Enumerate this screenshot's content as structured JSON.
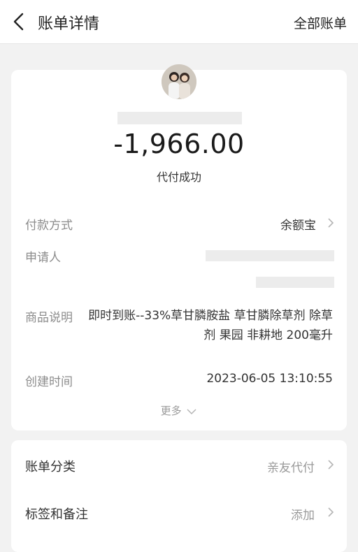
{
  "header": {
    "title": "账单详情",
    "right_link": "全部账单"
  },
  "summary": {
    "amount": "-1,966.00",
    "status": "代付成功"
  },
  "details": {
    "payment_method_label": "付款方式",
    "payment_method_value": "余额宝",
    "applicant_label": "申请人",
    "product_label": "商品说明",
    "product_value": "即时到账--33%草甘膦胺盐 草甘膦除草剂 除草剂 果园 非耕地 200毫升",
    "created_label": "创建时间",
    "created_value": "2023-06-05 13:10:55",
    "more_label": "更多"
  },
  "category": {
    "bill_category_label": "账单分类",
    "bill_category_value": "亲友代付",
    "tags_label": "标签和备注",
    "tags_value": "添加"
  },
  "icons": {
    "back": "back-arrow-icon",
    "chevron": "chevron-right-icon",
    "more": "chevron-down-icon"
  },
  "colors": {
    "background": "#f2f2f2",
    "card": "#ffffff",
    "label": "#8c8c8c",
    "text": "#333333"
  }
}
